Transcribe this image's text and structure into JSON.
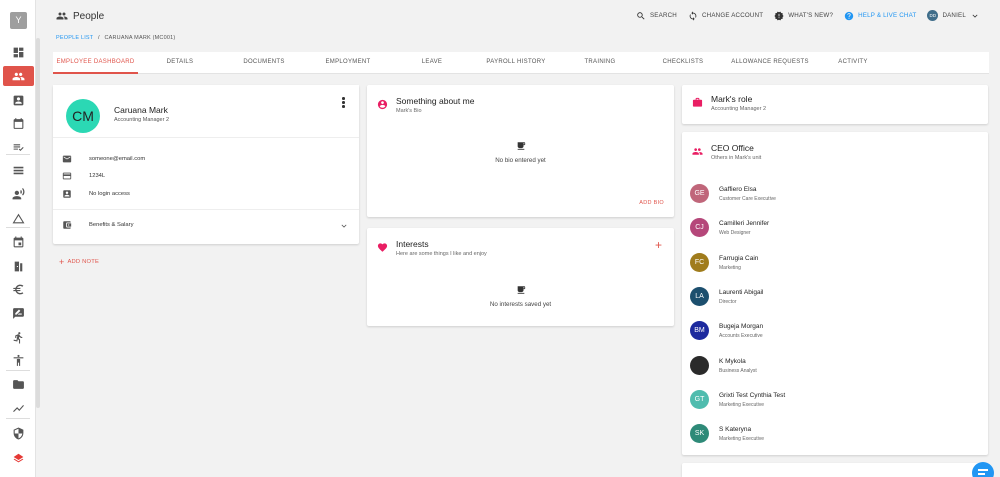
{
  "app": {
    "logo_letter": "Y"
  },
  "header": {
    "title": "People",
    "actions": [
      {
        "label": "SEARCH",
        "icon": "search-icon"
      },
      {
        "label": "CHANGE ACCOUNT",
        "icon": "swap-icon"
      },
      {
        "label": "WHAT'S NEW?",
        "icon": "gear-badge-icon"
      },
      {
        "label": "HELP & LIVE CHAT",
        "icon": "help-icon"
      }
    ],
    "user": {
      "initials": "DD",
      "name": "DANIEL"
    }
  },
  "breadcrumb": {
    "link": "PEOPLE LIST",
    "separator": "/",
    "current": "CARUANA MARK (MC001)"
  },
  "tabs": [
    "EMPLOYEE DASHBOARD",
    "DETAILS",
    "DOCUMENTS",
    "EMPLOYMENT",
    "LEAVE",
    "PAYROLL HISTORY",
    "TRAINING",
    "CHECKLISTS",
    "ALLOWANCE REQUESTS",
    "ACTIVITY"
  ],
  "active_tab": "EMPLOYEE DASHBOARD",
  "profile": {
    "initials": "CM",
    "name": "Caruana Mark",
    "job": "Accounting Manager 2",
    "email": "someone@email.com",
    "id_card": "1234L",
    "login": "No login access",
    "benefits": "Benefits & Salary"
  },
  "add_note": "ADD NOTE",
  "about": {
    "title": "Something about me",
    "sub": "Mark's Bio",
    "empty": "No bio entered yet",
    "action": "ADD BIO"
  },
  "interests": {
    "title": "Interests",
    "sub": "Here are some things I like and enjoy",
    "empty": "No interests saved yet",
    "plus": "+"
  },
  "role": {
    "title": "Mark's role",
    "sub": "Accounting Manager 2"
  },
  "unit": {
    "title": "CEO Office",
    "sub": "Others in Mark's unit",
    "members": [
      {
        "initials": "GE",
        "name": "Gaffiero Elsa",
        "job": "Customer Care Executive",
        "color": "#c0667a"
      },
      {
        "initials": "CJ",
        "name": "Camilleri Jennifer",
        "job": "Web Designer",
        "color": "#b5477a"
      },
      {
        "initials": "FC",
        "name": "Farrugia Cain",
        "job": "Marketing",
        "color": "#a07c1c"
      },
      {
        "initials": "LA",
        "name": "Laurenti Abigail",
        "job": "Director",
        "color": "#1c4f6e"
      },
      {
        "initials": "BM",
        "name": "Bugeja Morgan",
        "job": "Accounts Executive",
        "color": "#1d2a9e"
      },
      {
        "initials": "",
        "name": "K Mykola",
        "job": "Business Analyst",
        "color": "#2a2a2a"
      },
      {
        "initials": "GT",
        "name": "Grixti Test Cynthia Test",
        "job": "Marketing Executive",
        "color": "#4fbcae"
      },
      {
        "initials": "SK",
        "name": "S Kateryna",
        "job": "Marketing Executive",
        "color": "#2e8a78"
      }
    ]
  },
  "colors": {
    "accent": "#e0544b",
    "link": "#2196f3",
    "heart": "#e91e63"
  }
}
